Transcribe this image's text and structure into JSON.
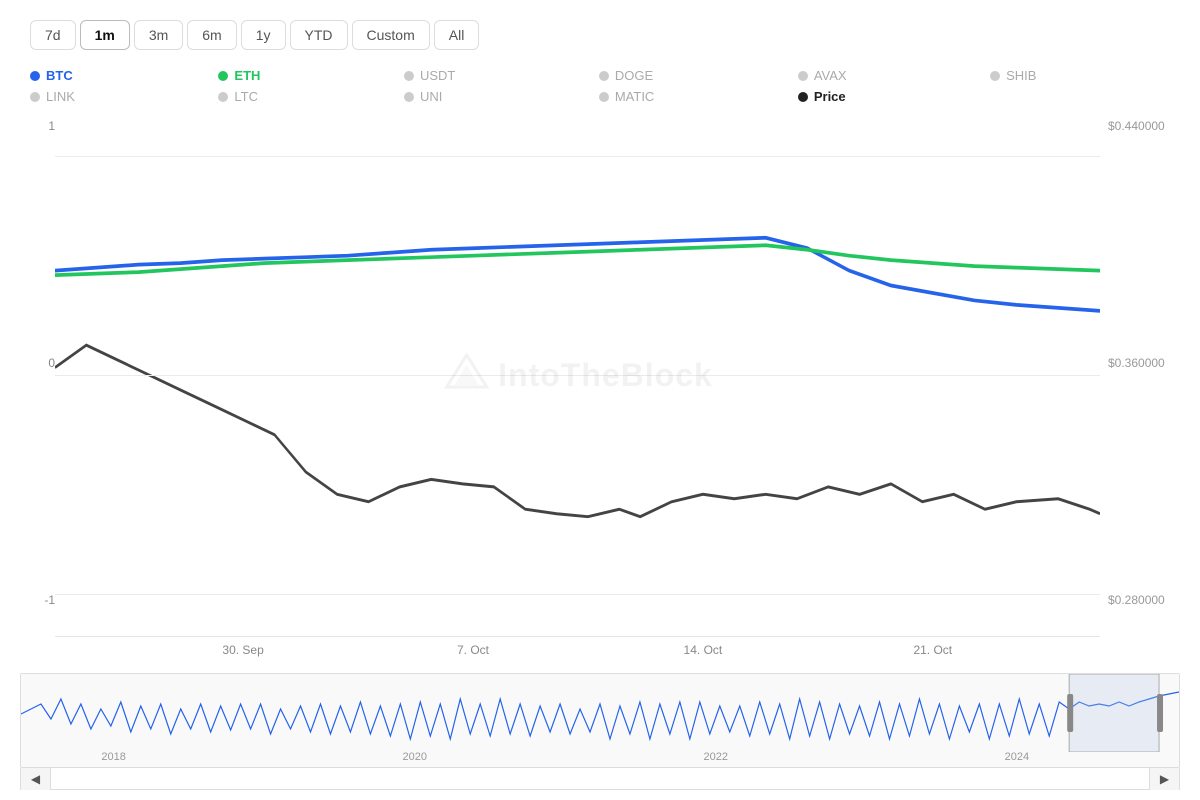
{
  "timeButtons": [
    {
      "label": "7d",
      "active": false
    },
    {
      "label": "1m",
      "active": true
    },
    {
      "label": "3m",
      "active": false
    },
    {
      "label": "6m",
      "active": false
    },
    {
      "label": "1y",
      "active": false
    },
    {
      "label": "YTD",
      "active": false
    },
    {
      "label": "Custom",
      "active": false
    },
    {
      "label": "All",
      "active": false
    }
  ],
  "legend": {
    "row1": [
      {
        "dot_color": "#2563eb",
        "label": "BTC",
        "class": "active-btc"
      },
      {
        "dot_color": "#22c55e",
        "label": "ETH",
        "class": "active-eth"
      },
      {
        "dot_color": "#ccc",
        "label": "USDT",
        "class": ""
      },
      {
        "dot_color": "#ccc",
        "label": "DOGE",
        "class": ""
      },
      {
        "dot_color": "#ccc",
        "label": "AVAX",
        "class": ""
      },
      {
        "dot_color": "#ccc",
        "label": "SHIB",
        "class": ""
      }
    ],
    "row2": [
      {
        "dot_color": "#ccc",
        "label": "LINK",
        "class": ""
      },
      {
        "dot_color": "#ccc",
        "label": "LTC",
        "class": ""
      },
      {
        "dot_color": "#ccc",
        "label": "UNI",
        "class": ""
      },
      {
        "dot_color": "#ccc",
        "label": "MATIC",
        "class": ""
      },
      {
        "dot_color": "#222",
        "label": "Price",
        "class": "active-price"
      },
      {
        "dot_color": "transparent",
        "label": "",
        "class": ""
      }
    ]
  },
  "yAxis": {
    "left": [
      "1",
      "0",
      "-1"
    ],
    "right": [
      "$0.440000",
      "$0.360000",
      "$0.280000"
    ]
  },
  "xAxis": [
    "30. Sep",
    "7. Oct",
    "14. Oct",
    "21. Oct"
  ],
  "navigatorYears": [
    "2018",
    "2020",
    "2022",
    "2024"
  ],
  "watermark": "IntoTheBlock"
}
